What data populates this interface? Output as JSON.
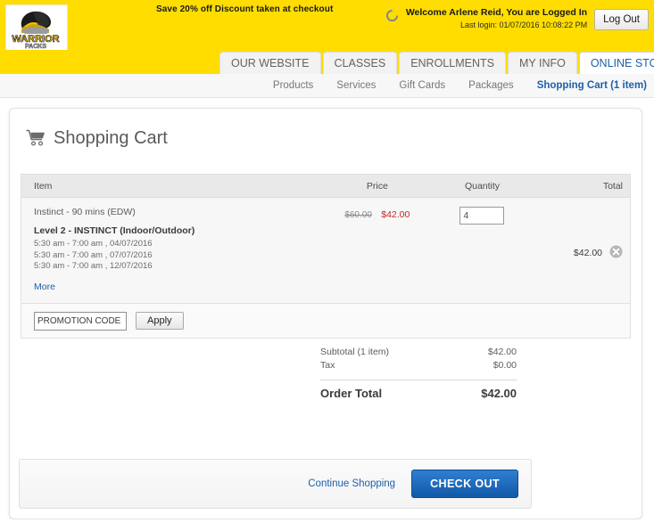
{
  "topbar": {
    "logo": {
      "name": "warrior-packs-logo",
      "word_top": "WARRIOR",
      "word_bottom": "PACKS"
    },
    "promo_banner": "Save 20% off Discount taken at checkout",
    "spinner_icon": "spinner-icon",
    "welcome": "Welcome Arlene Reid, You are Logged In",
    "last_login": "Last login: 01/07/2016 10:08:22 PM",
    "logout_label": "Log Out",
    "background_color": "#FFDD00"
  },
  "tabs": [
    {
      "label": "OUR WEBSITE",
      "active": false
    },
    {
      "label": "CLASSES",
      "active": false
    },
    {
      "label": "ENROLLMENTS",
      "active": false
    },
    {
      "label": "MY INFO",
      "active": false
    },
    {
      "label": "ONLINE STORE",
      "active": true
    }
  ],
  "subnav": [
    {
      "label": "Products",
      "active": false
    },
    {
      "label": "Services",
      "active": false
    },
    {
      "label": "Gift Cards",
      "active": false
    },
    {
      "label": "Packages",
      "active": false
    },
    {
      "label": "Shopping Cart (1 item)",
      "active": true
    }
  ],
  "page": {
    "title": "Shopping Cart",
    "cart_icon": "shopping-cart-icon"
  },
  "cart": {
    "columns": {
      "item": "Item",
      "price": "Price",
      "quantity": "Quantity",
      "total": "Total"
    },
    "rows": [
      {
        "name": "Instinct - 90 mins (EDW)",
        "sub_title": "Level 2 - INSTINCT (Indoor/Outdoor)",
        "sessions": [
          "5:30 am - 7:00 am , 04/07/2016",
          "5:30 am - 7:00 am , 07/07/2016",
          "5:30 am - 7:00 am , 12/07/2016"
        ],
        "more_label": "More",
        "price_original": "$60.00",
        "price_sale": "$42.00",
        "quantity": "4",
        "total": "$42.00",
        "remove_icon": "remove-item-icon"
      }
    ],
    "promo": {
      "value": "PROMOTION CODE",
      "placeholder": "PROMOTION CODE",
      "apply_label": "Apply"
    }
  },
  "totals": {
    "subtotal_label": "Subtotal  (1 item)",
    "subtotal_value": "$42.00",
    "tax_label": "Tax",
    "tax_value": "$0.00",
    "order_total_label": "Order Total",
    "order_total_value": "$42.00"
  },
  "actions": {
    "continue_label": "Continue Shopping",
    "checkout_label": "CHECK OUT"
  },
  "colors": {
    "brand_yellow": "#FFDD00",
    "link_blue": "#1F5FA9",
    "sale_red": "#CC2222",
    "checkout_blue": "#1258A8"
  }
}
